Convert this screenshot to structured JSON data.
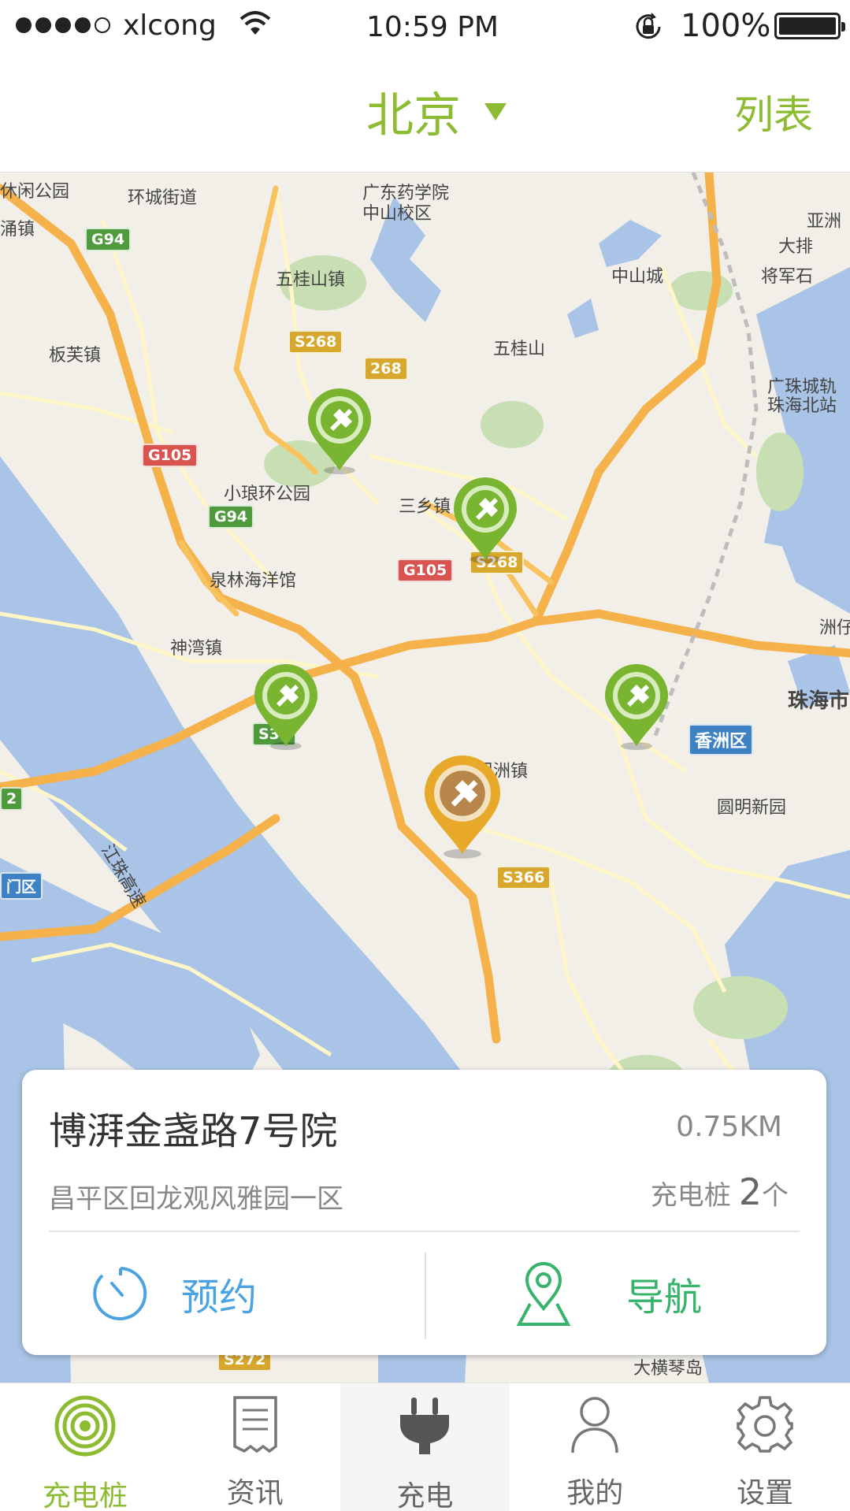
{
  "status_bar": {
    "carrier": "xlcong",
    "time": "10:59 PM",
    "battery": "100%",
    "signal_bars": 4
  },
  "nav": {
    "city": "北京",
    "list_label": "列表"
  },
  "map": {
    "labels": [
      {
        "text": "休闲公园"
      },
      {
        "text": "环城街道"
      },
      {
        "text": "广东药学院"
      },
      {
        "text": "中山校区"
      },
      {
        "text": "亚洲"
      },
      {
        "text": "大排"
      },
      {
        "text": "将军石"
      },
      {
        "text": "涌镇"
      },
      {
        "text": "五桂山镇"
      },
      {
        "text": "中山城"
      },
      {
        "text": "板芙镇"
      },
      {
        "text": "五桂山"
      },
      {
        "text": "广珠城轨"
      },
      {
        "text": "珠海北站"
      },
      {
        "text": "小琅环公园"
      },
      {
        "text": "三乡镇"
      },
      {
        "text": "泉林海洋馆"
      },
      {
        "text": "神湾镇"
      },
      {
        "text": "洲仔"
      },
      {
        "text": "珠海市"
      },
      {
        "text": "坦洲镇"
      },
      {
        "text": "圆明新园"
      },
      {
        "text": "大横琴岛"
      },
      {
        "text": "江珠高速"
      }
    ],
    "road_signs": [
      {
        "text": "G94"
      },
      {
        "text": "S268"
      },
      {
        "text": "268"
      },
      {
        "text": "G105"
      },
      {
        "text": "G94"
      },
      {
        "text": "G105"
      },
      {
        "text": "S268"
      },
      {
        "text": "S32"
      },
      {
        "text": "S366"
      },
      {
        "text": "S272"
      },
      {
        "text": "2"
      },
      {
        "text": "门区"
      },
      {
        "text": "香洲区"
      }
    ],
    "pins": [
      {
        "status": "available",
        "color": "#79b531"
      },
      {
        "status": "available",
        "color": "#79b531"
      },
      {
        "status": "available",
        "color": "#79b531"
      },
      {
        "status": "available",
        "color": "#79b531"
      },
      {
        "status": "selected",
        "color": "#e8a92a"
      }
    ]
  },
  "station_card": {
    "name": "博湃金盏路7号院",
    "distance": "0.75KM",
    "address": "昌平区回龙观风雅园一区",
    "pile_label": "充电桩",
    "pile_count": "2",
    "pile_unit": "个",
    "reserve_label": "预约",
    "navigate_label": "导航"
  },
  "tabs": [
    {
      "label": "充电桩",
      "icon": "radar-icon",
      "active": true
    },
    {
      "label": "资讯",
      "icon": "receipt-icon",
      "active": false
    },
    {
      "label": "充电",
      "icon": "plug-icon",
      "active": false
    },
    {
      "label": "我的",
      "icon": "user-icon",
      "active": false
    },
    {
      "label": "设置",
      "icon": "gear-icon",
      "active": false
    }
  ],
  "colors": {
    "accent": "#8dbb32",
    "reserve_blue": "#4aa3e0",
    "navigate_green": "#37b36b",
    "pin_green": "#79b531",
    "pin_orange": "#e8a92a"
  }
}
